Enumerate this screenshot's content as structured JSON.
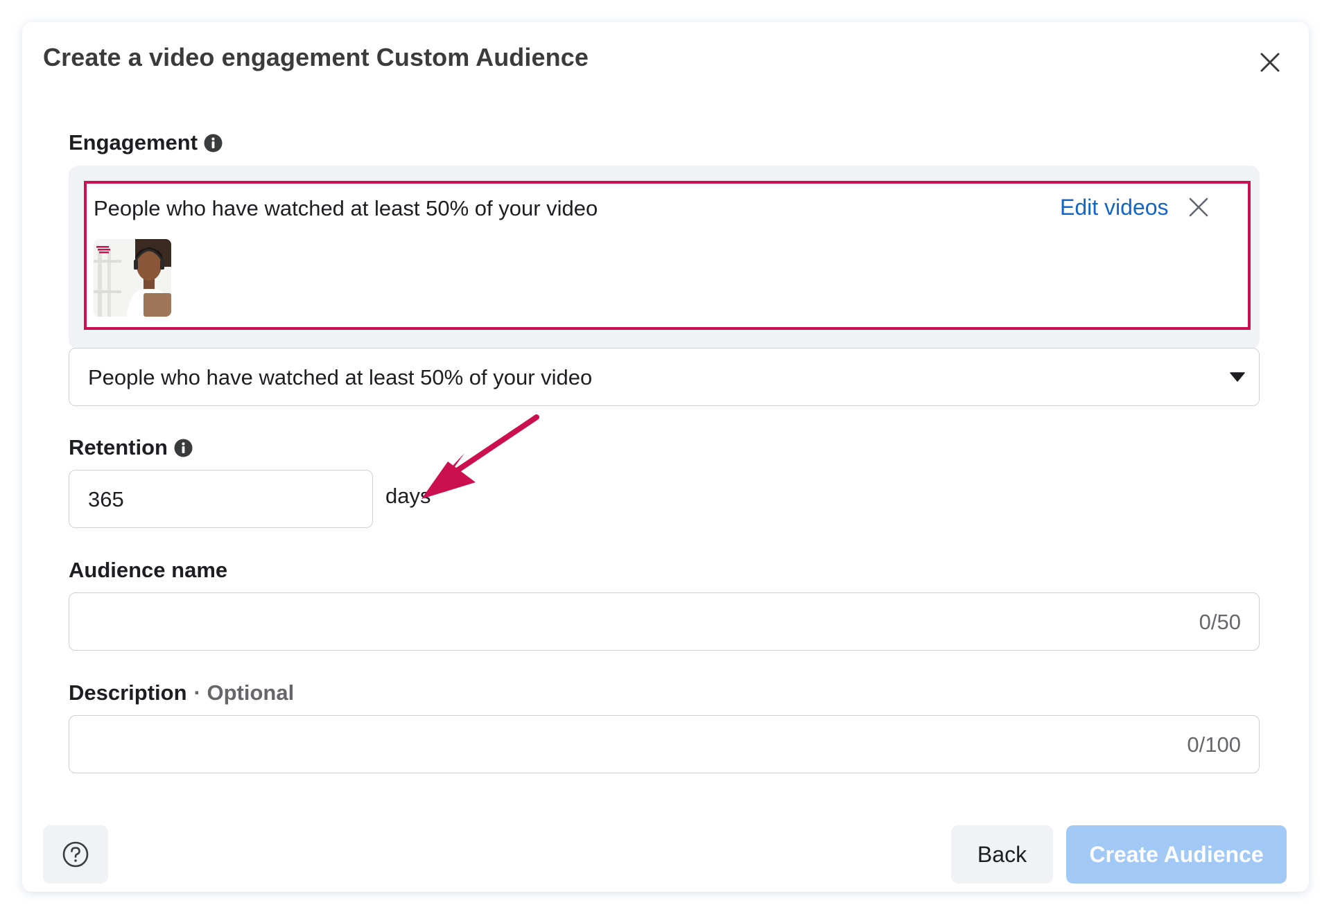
{
  "dialog": {
    "title": "Create a video engagement Custom Audience"
  },
  "engagement": {
    "label": "Engagement",
    "card_text": "People who have watched at least 50% of your video",
    "edit_link": "Edit videos",
    "select_value": "People who have watched at least 50% of your video"
  },
  "retention": {
    "label": "Retention",
    "value": "365",
    "unit": "days"
  },
  "audience_name": {
    "label": "Audience name",
    "value": "",
    "counter": "0/50"
  },
  "description": {
    "label": "Description",
    "optional": "· Optional",
    "value": "",
    "counter": "0/100"
  },
  "footer": {
    "back_label": "Back",
    "create_label": "Create Audience"
  },
  "icons": {
    "close": "close-icon",
    "info": "info-icon",
    "dropdown": "caret-down-icon",
    "help": "question-circle-icon",
    "highlight_arrow": "arrow-annotation"
  },
  "colors": {
    "highlight_border": "#cc0f4f",
    "link": "#1366c7",
    "primary_disabled": "#a2c8f5",
    "annotation_arrow": "#cc0f4f"
  }
}
